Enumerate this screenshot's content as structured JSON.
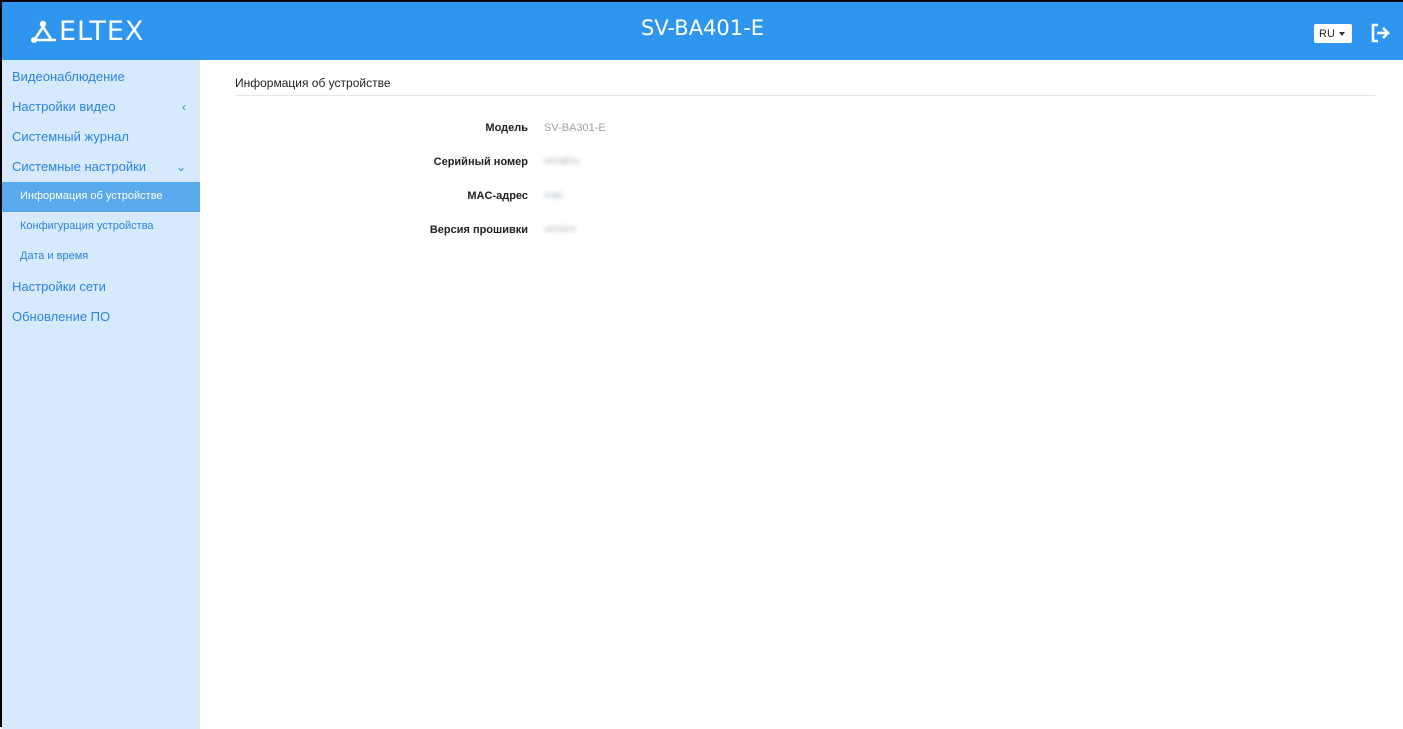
{
  "header": {
    "logo_text": "ELTEX",
    "device_title": "SV-BA401-E",
    "language": "RU",
    "brand_color": "#2f96f0"
  },
  "icons": {
    "logo": "eltex-logo-icon",
    "logout": "logout-icon",
    "collapsed": "chevron-left-icon",
    "expanded": "chevron-down-icon",
    "dropdown": "caret-down-icon"
  },
  "sidebar": {
    "items": [
      {
        "label": "Видеонаблюдение"
      },
      {
        "label": "Настройки видео",
        "chevron": "‹"
      },
      {
        "label": "Системный журнал"
      },
      {
        "label": "Системные настройки",
        "chevron": "⌄"
      }
    ],
    "sub_items": [
      {
        "label": "Информация об устройстве",
        "active": true
      },
      {
        "label": "Конфигурация устройства"
      },
      {
        "label": "Дата и время"
      }
    ],
    "items_after": [
      {
        "label": "Настройки сети"
      },
      {
        "label": "Обновление ПО"
      }
    ]
  },
  "main": {
    "title": "Информация об устройстве",
    "fields": [
      {
        "label": "Модель",
        "value": "SV-BA301-E"
      },
      {
        "label": "Серийный номер",
        "value": "serialno"
      },
      {
        "label": "MAC-адрес",
        "value": "mac"
      },
      {
        "label": "Версия прошивки",
        "value": "version"
      }
    ]
  }
}
